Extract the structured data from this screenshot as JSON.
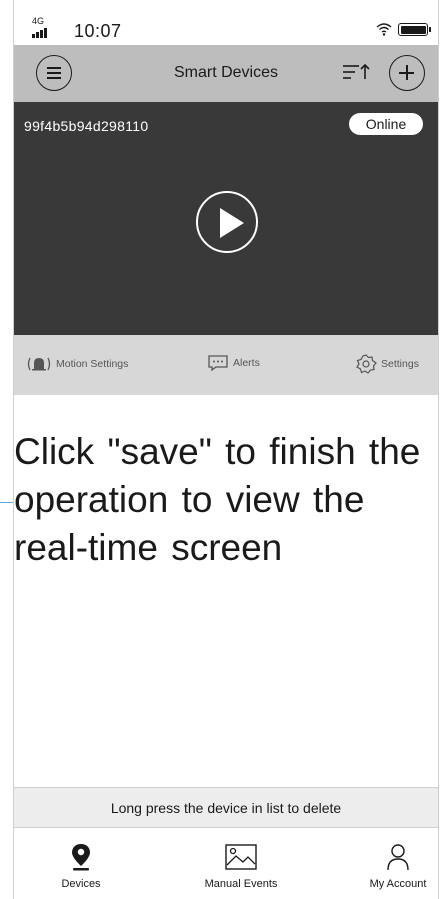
{
  "status_bar": {
    "network": "4G",
    "time": "10:07"
  },
  "header": {
    "title": "Smart Devices"
  },
  "device": {
    "id": "99f4b5b94d298110",
    "status": "Online"
  },
  "toolbar": {
    "motion_settings": "Motion Settings",
    "alerts": "Alerts",
    "settings": "Settings"
  },
  "instruction": {
    "text": "Click \"save\" to finish the operation to view the real-time screen"
  },
  "footer": {
    "delete_hint": "Long press the device in list to delete"
  },
  "bottom_nav": {
    "devices": "Devices",
    "manual_events": "Manual Events",
    "my_account": "My Account"
  },
  "colors": {
    "header_bg": "#bdbdbd",
    "video_bg": "#3a3939",
    "toolbar_bg": "#d7d7d7",
    "footer_hint_bg": "#ededed",
    "callout": "#5aa9d6"
  },
  "icons": {
    "menu": "list-menu-icon",
    "sort": "sort-icon",
    "add": "plus-icon",
    "play": "play-icon",
    "motion": "bell-icon",
    "alerts": "message-icon",
    "settings": "gear-icon",
    "devices": "location-pin-icon",
    "manual_events": "image-icon",
    "account": "user-icon"
  }
}
